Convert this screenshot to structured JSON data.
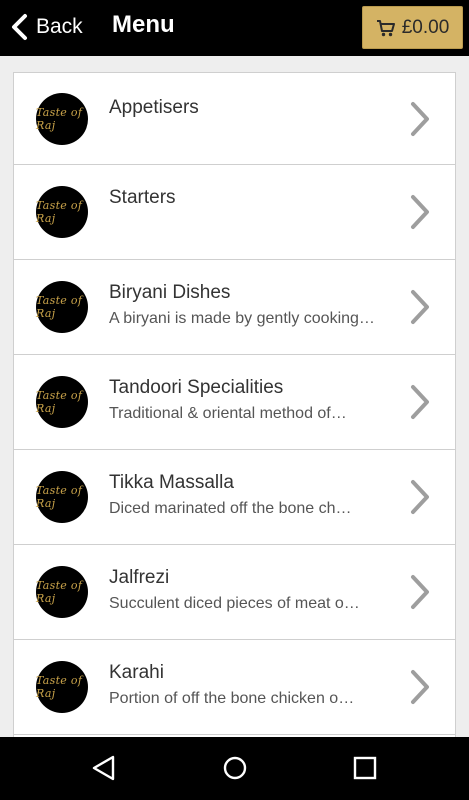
{
  "header": {
    "back_label": "Back",
    "title": "Menu",
    "cart_total": "£0.00"
  },
  "brand": {
    "logo_text": "Taste of Raj"
  },
  "menu": [
    {
      "name": "Appetisers",
      "description": ""
    },
    {
      "name": "Starters",
      "description": ""
    },
    {
      "name": "Biryani Dishes",
      "description": "A biryani is made by gently cooking…"
    },
    {
      "name": "Tandoori Specialities",
      "description": "Traditional & oriental method of…"
    },
    {
      "name": "Tikka Massalla",
      "description": "Diced marinated off the bone  ch…"
    },
    {
      "name": "Jalfrezi",
      "description": "Succulent diced pieces of meat o…"
    },
    {
      "name": "Karahi",
      "description": "Portion of off the bone chicken o…"
    }
  ],
  "colors": {
    "header_bg": "#000000",
    "cart_button": "#d4b364",
    "page_bg": "#eeeeee",
    "chevron": "#9e9e9e"
  },
  "icons": {
    "back": "chevron-left-icon",
    "cart": "cart-icon",
    "row": "chevron-right-icon",
    "nav_back": "triangle-back-icon",
    "nav_home": "circle-home-icon",
    "nav_recents": "square-recents-icon"
  }
}
